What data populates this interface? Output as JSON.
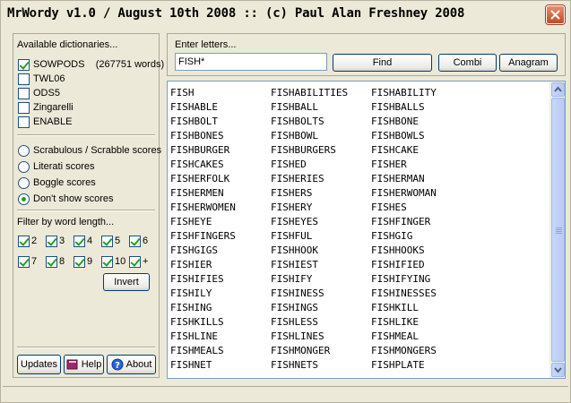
{
  "window": {
    "title": "MrWordy v1.0 / August 10th 2008 :: (c) Paul Alan Freshney 2008"
  },
  "dictionaries": {
    "label": "Available dictionaries...",
    "items": [
      {
        "name": "SOWPODS",
        "extra": "(267751 words)",
        "checked": true
      },
      {
        "name": "TWL06",
        "extra": "",
        "checked": false
      },
      {
        "name": "ODS5",
        "extra": "",
        "checked": false
      },
      {
        "name": "Zingarelli",
        "extra": "",
        "checked": false
      },
      {
        "name": "ENABLE",
        "extra": "",
        "checked": false
      }
    ]
  },
  "scores": {
    "options": [
      {
        "label": "Scrabulous / Scrabble scores",
        "selected": false
      },
      {
        "label": "Literati scores",
        "selected": false
      },
      {
        "label": "Boggle scores",
        "selected": false
      },
      {
        "label": "Don't show scores",
        "selected": true
      }
    ]
  },
  "length_filter": {
    "label": "Filter by word length...",
    "row1": [
      {
        "label": "2",
        "checked": true
      },
      {
        "label": "3",
        "checked": true
      },
      {
        "label": "4",
        "checked": true
      },
      {
        "label": "5",
        "checked": true
      },
      {
        "label": "6",
        "checked": true
      }
    ],
    "row2": [
      {
        "label": "7",
        "checked": true
      },
      {
        "label": "8",
        "checked": true
      },
      {
        "label": "9",
        "checked": true
      },
      {
        "label": "10",
        "checked": true
      },
      {
        "label": "+",
        "checked": true
      }
    ],
    "invert_label": "Invert"
  },
  "bottom_buttons": {
    "updates": "Updates",
    "help": "Help",
    "about": "About"
  },
  "search": {
    "label": "Enter letters...",
    "value": "FISH*",
    "find_label": "Find",
    "combi_label": "Combi",
    "anagram_label": "Anagram"
  },
  "results": [
    [
      "FISH",
      "FISHABILITIES",
      "FISHABILITY"
    ],
    [
      "FISHABLE",
      "FISHBALL",
      "FISHBALLS"
    ],
    [
      "FISHBOLT",
      "FISHBOLTS",
      "FISHBONE"
    ],
    [
      "FISHBONES",
      "FISHBOWL",
      "FISHBOWLS"
    ],
    [
      "FISHBURGER",
      "FISHBURGERS",
      "FISHCAKE"
    ],
    [
      "FISHCAKES",
      "FISHED",
      "FISHER"
    ],
    [
      "FISHERFOLK",
      "FISHERIES",
      "FISHERMAN"
    ],
    [
      "FISHERMEN",
      "FISHERS",
      "FISHERWOMAN"
    ],
    [
      "FISHERWOMEN",
      "FISHERY",
      "FISHES"
    ],
    [
      "FISHEYE",
      "FISHEYES",
      "FISHFINGER"
    ],
    [
      "FISHFINGERS",
      "FISHFUL",
      "FISHGIG"
    ],
    [
      "FISHGIGS",
      "FISHHOOK",
      "FISHHOOKS"
    ],
    [
      "FISHIER",
      "FISHIEST",
      "FISHIFIED"
    ],
    [
      "FISHIFIES",
      "FISHIFY",
      "FISHIFYING"
    ],
    [
      "FISHILY",
      "FISHINESS",
      "FISHINESSES"
    ],
    [
      "FISHING",
      "FISHINGS",
      "FISHKILL"
    ],
    [
      "FISHKILLS",
      "FISHLESS",
      "FISHLIKE"
    ],
    [
      "FISHLINE",
      "FISHLINES",
      "FISHMEAL"
    ],
    [
      "FISHMEALS",
      "FISHMONGER",
      "FISHMONGERS"
    ],
    [
      "FISHNET",
      "FISHNETS",
      "FISHPLATE"
    ]
  ],
  "colors": {
    "window_bg": "#ece9d8",
    "checkmark": "#21a121",
    "close_button": "#c64a26"
  }
}
